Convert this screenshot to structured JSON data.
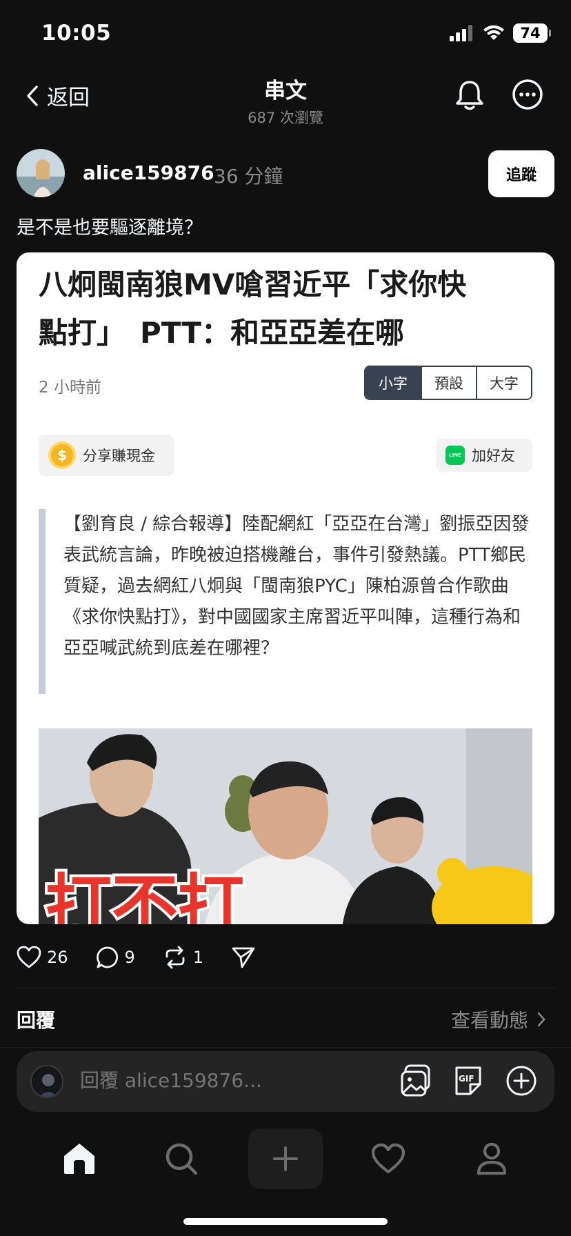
{
  "status_bar": {
    "time": "10:05",
    "battery": "74"
  },
  "nav": {
    "back_label": "返回",
    "title": "串文",
    "views": "687 次瀏覽"
  },
  "post": {
    "username": "alice159876",
    "time_ago": "36 分鐘",
    "follow_label": "追蹤",
    "text": "是不是也要驅逐離境？"
  },
  "card": {
    "headline_line1": "八炯閩南狼MV嗆習近平「求你快",
    "headline_line2": "點打」　PTT：和亞亞差在哪",
    "time": "2 小時前",
    "font_sizes": [
      "小字",
      "預設",
      "大字"
    ],
    "active_font_size": "小字",
    "share_label": "分享賺現金",
    "coin_symbol": "$",
    "line_icon_text": "LINE",
    "line_label": "加好友",
    "quote": "【劉育良 / 綜合報導】陸配網紅「亞亞在台灣」劉振亞因發表武統言論，昨晚被迫搭機離台，事件引發熱議。PTT鄉民質疑，過去網紅八炯與「閩南狼PYC」陳柏源曾合作歌曲《求你快點打》，對中國國家主席習近平叫陣，這種行為和亞亞喊武統到底差在哪裡？",
    "image_caption": "打不打"
  },
  "actions": {
    "likes": "26",
    "comments": "9",
    "reposts": "1"
  },
  "replies": {
    "label": "回覆",
    "view_activity": "查看動態"
  },
  "reply_bar": {
    "placeholder": "回覆 alice159876..."
  },
  "tabbar": {
    "items": [
      "home-icon",
      "search-icon",
      "plus-icon",
      "heart-icon",
      "profile-icon"
    ]
  },
  "colors": {
    "background": "#101010",
    "card": "#ffffff",
    "size_active": "#3a4150",
    "line_green": "#06c755",
    "coin": "#f5b623"
  }
}
